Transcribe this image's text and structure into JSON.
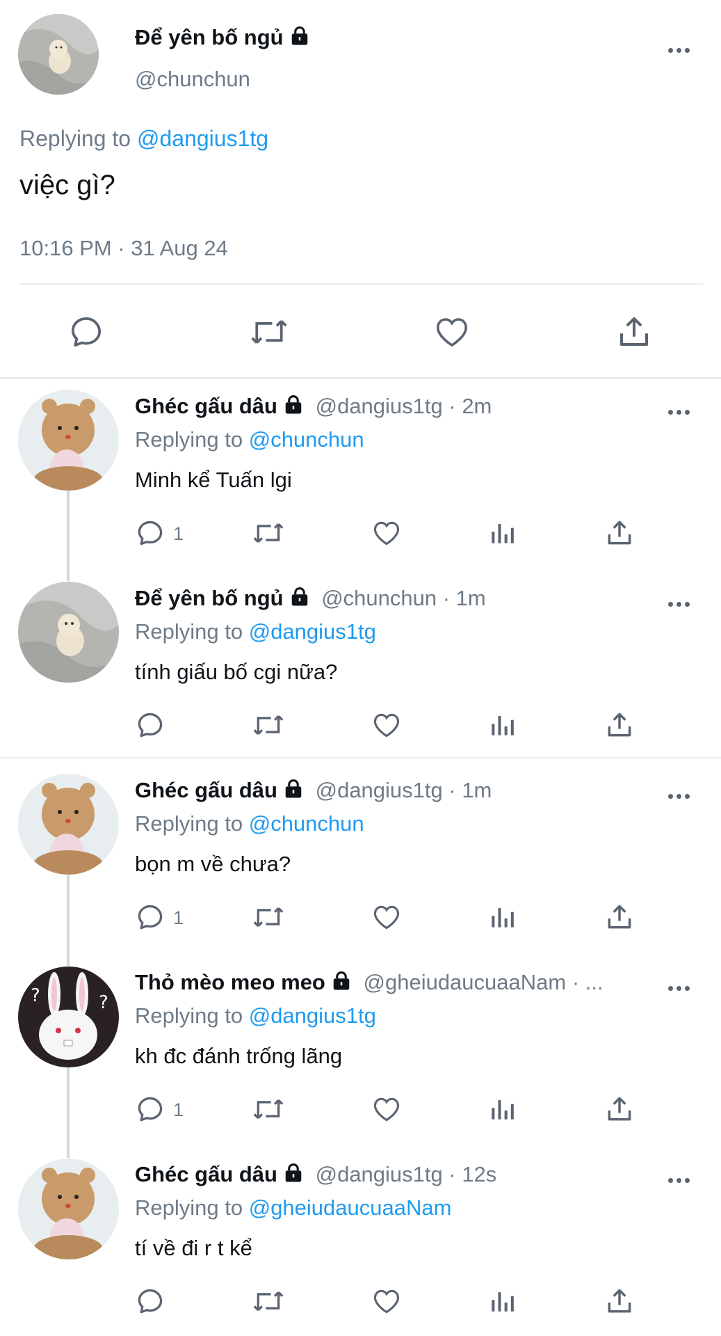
{
  "main_tweet": {
    "display_name": "Để yên bố ngủ",
    "handle": "@chunchun",
    "replying_prefix": "Replying to ",
    "replying_to": "@dangius1tg",
    "text": "việc gì?",
    "timestamp": "10:16 PM · 31 Aug 24"
  },
  "replies": [
    {
      "name": "Ghéc gấu dâu",
      "meta": "@dangius1tg · 2m",
      "replying_prefix": "Replying to ",
      "replying_to": "@chunchun",
      "text": "Minh kể Tuấn lgi",
      "reply_count": "1"
    },
    {
      "name": "Để yên bố ngủ",
      "meta": "@chunchun · 1m",
      "replying_prefix": "Replying to ",
      "replying_to": "@dangius1tg",
      "text": "tính giấu bố cgi nữa?",
      "reply_count": ""
    },
    {
      "name": "Ghéc gấu dâu",
      "meta": "@dangius1tg · 1m",
      "replying_prefix": "Replying to ",
      "replying_to": "@chunchun",
      "text": "bọn m về chưa?",
      "reply_count": "1"
    },
    {
      "name": "Thỏ mèo meo meo",
      "meta": "@gheiudaucuaaNam · ...",
      "replying_prefix": "Replying to ",
      "replying_to": "@dangius1tg",
      "text": "kh đc đánh trống lãng",
      "reply_count": "1"
    },
    {
      "name": "Ghéc gấu dâu",
      "meta": "@dangius1tg · 12s",
      "replying_prefix": "Replying to ",
      "replying_to": "@gheiudaucuaaNam",
      "text": "tí về đi r t kể",
      "reply_count": ""
    }
  ],
  "icons": {
    "reply": "reply-icon",
    "retweet": "retweet-icon",
    "like": "heart-icon",
    "views": "analytics-icon",
    "share": "share-icon",
    "more": "more-icon",
    "lock": "lock-icon"
  },
  "colors": {
    "link": "#1d9bf0",
    "secondary": "#6e7b88",
    "divider": "#e6ecf0"
  }
}
